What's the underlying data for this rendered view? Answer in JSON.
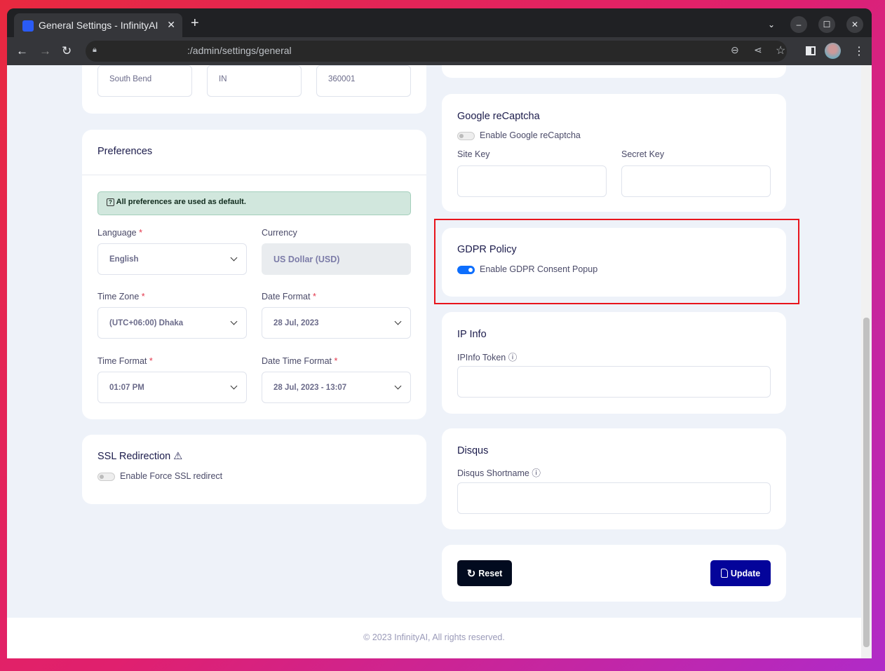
{
  "browser": {
    "tab_title": "General Settings - InfinityAI",
    "url_host": "",
    "url_path": ":/admin/settings/general"
  },
  "address": {
    "city": "South Bend",
    "country": "IN",
    "zip": "360001"
  },
  "preferences": {
    "title": "Preferences",
    "alert": "All preferences are used as default.",
    "language_label": "Language",
    "language": "English",
    "currency_label": "Currency",
    "currency": "US Dollar (USD)",
    "timezone_label": "Time Zone",
    "timezone": "(UTC+06:00) Dhaka",
    "date_format_label": "Date Format",
    "date_format": "28 Jul, 2023",
    "time_format_label": "Time Format",
    "time_format": "01:07 PM",
    "datetime_format_label": "Date Time Format",
    "datetime_format": "28 Jul, 2023 - 13:07",
    "required_mark": "*"
  },
  "ssl": {
    "title": "SSL Redirection",
    "toggle_label": "Enable Force SSL redirect",
    "enabled": false
  },
  "recaptcha": {
    "title": "Google reCaptcha",
    "toggle_label": "Enable Google reCaptcha",
    "enabled": false,
    "site_key_label": "Site Key",
    "secret_key_label": "Secret Key",
    "site_key": "",
    "secret_key": ""
  },
  "gdpr": {
    "title": "GDPR Policy",
    "toggle_label": "Enable GDPR Consent Popup",
    "enabled": true,
    "highlight_color": "#e8141c"
  },
  "ipinfo": {
    "title": "IP Info",
    "token_label": "IPInfo Token",
    "token": ""
  },
  "disqus": {
    "title": "Disqus",
    "shortname_label": "Disqus Shortname",
    "shortname": ""
  },
  "actions": {
    "reset": "Reset",
    "update": "Update",
    "reset_color": "#020b1f",
    "update_color": "#04049a"
  },
  "footer": {
    "text": "© 2023 InfinityAI, All rights reserved."
  }
}
